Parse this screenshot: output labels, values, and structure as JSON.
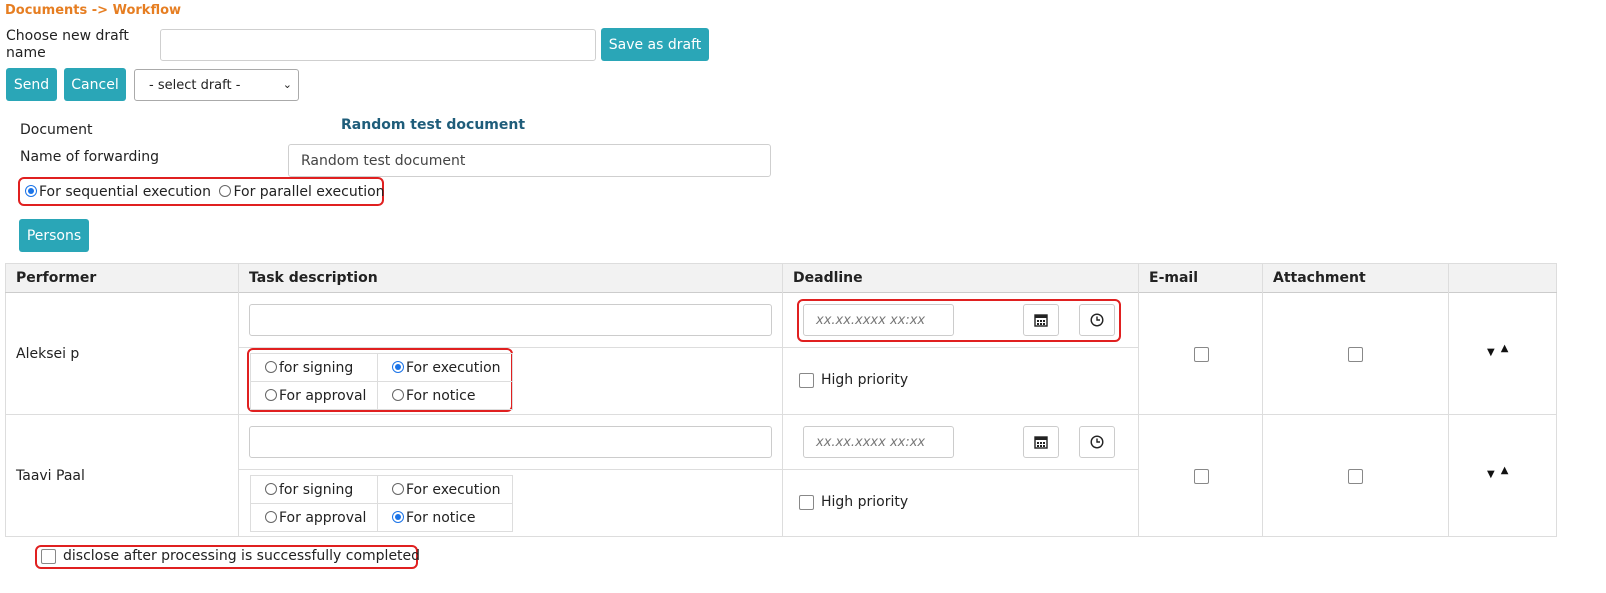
{
  "breadcrumb": "Documents -> Workflow",
  "draft": {
    "label_line1": "Choose new draft",
    "label_line2": "name",
    "name_value": "",
    "save_label": "Save as draft",
    "select_value": "- select draft -"
  },
  "actions": {
    "send_label": "Send",
    "cancel_label": "Cancel"
  },
  "document": {
    "label": "Document",
    "title": "Random test document",
    "forwarding_label": "Name of forwarding",
    "forwarding_value": "Random test document"
  },
  "execution_mode": {
    "sequential_label": "For sequential execution",
    "parallel_label": "For parallel execution",
    "selected": "sequential"
  },
  "persons_label": "Persons",
  "table": {
    "headers": {
      "performer": "Performer",
      "task": "Task description",
      "deadline": "Deadline",
      "email": "E-mail",
      "attachment": "Attachment"
    },
    "rows": [
      {
        "performer": "Aleksei p",
        "task": "",
        "deadline_placeholder": "xx.xx.xxxx xx:xx",
        "options": {
          "signing": "for signing",
          "execution": "For execution",
          "approval": "For approval",
          "notice": "For notice"
        },
        "selected_option": "execution",
        "priority_label": "High priority",
        "priority_checked": false,
        "email_checked": false,
        "attachment_checked": false
      },
      {
        "performer": "Taavi Paal",
        "task": "",
        "deadline_placeholder": "xx.xx.xxxx xx:xx",
        "options": {
          "signing": "for signing",
          "execution": "For execution",
          "approval": "For approval",
          "notice": "For notice"
        },
        "selected_option": "notice",
        "priority_label": "High priority",
        "priority_checked": false,
        "email_checked": false,
        "attachment_checked": false
      }
    ]
  },
  "disclose_label": "disclose after processing is successfully completed",
  "disclose_checked": false,
  "icons": {
    "calendar": "calendar-icon",
    "clock": "clock-icon",
    "move_down": "arrow-down-icon",
    "move_up": "arrow-up-icon"
  },
  "colors": {
    "accent": "#2aa6b7",
    "breadcrumb": "#e67e22",
    "title": "#1f5d7a",
    "highlight": "#e02020",
    "radio": "#1a73e8"
  }
}
